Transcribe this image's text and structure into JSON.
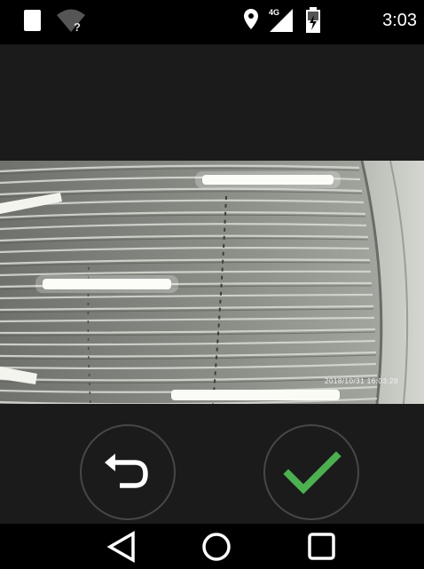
{
  "status_bar": {
    "time": "3:03",
    "network_type": "4G",
    "icons": [
      "notification-icon",
      "wifi-unknown-icon",
      "location-icon",
      "signal-icon",
      "battery-charging-icon"
    ]
  },
  "preview": {
    "timestamp_overlay": "2018/10/31  16:03:28",
    "subject": "window-blinds-photo"
  },
  "actions": {
    "retake_icon": "undo-arrow-icon",
    "confirm_icon": "checkmark-icon",
    "confirm_color": "#4caf50",
    "ring_color": "#474747"
  },
  "nav_bar": {
    "icons": [
      "back-triangle-icon",
      "home-circle-icon",
      "recents-square-icon"
    ]
  }
}
